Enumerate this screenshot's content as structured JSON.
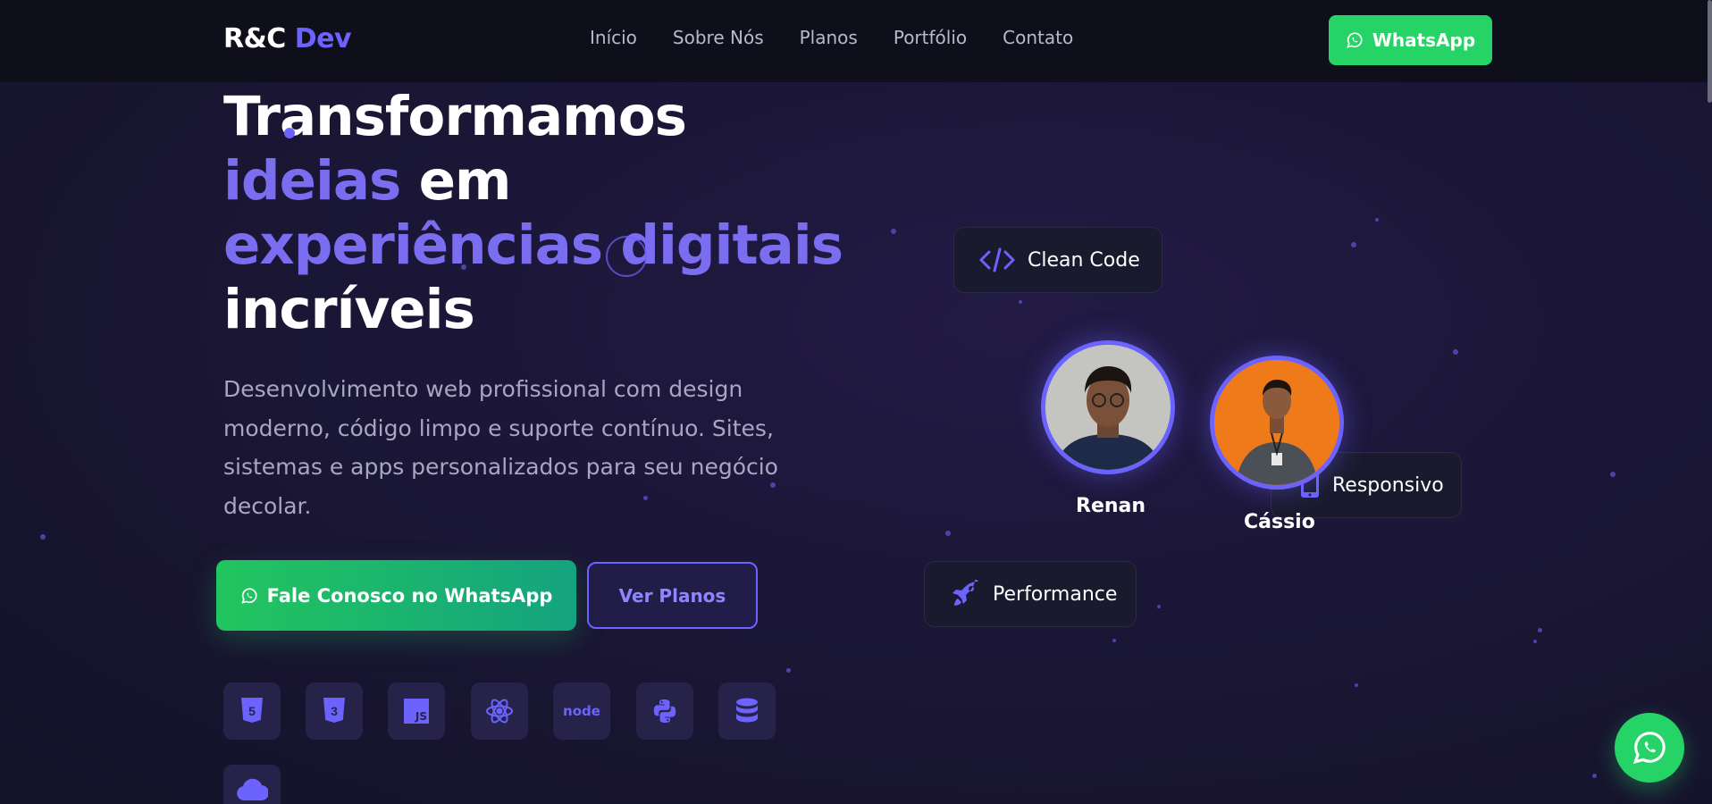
{
  "brand": {
    "name": "R&C",
    "accent": "Dev"
  },
  "nav": {
    "links": [
      "Início",
      "Sobre Nós",
      "Planos",
      "Portfólio",
      "Contato"
    ],
    "cta_label": "WhatsApp"
  },
  "hero": {
    "title_line1": "Transformamos",
    "title_line2_accent": "ideias",
    "title_line2_rest": " em",
    "title_line3_accent": "experiências digitais",
    "title_line4": "incríveis",
    "subtitle": "Desenvolvimento web profissional com design moderno, código limpo e suporte contínuo. Sites, sistemas e apps personalizados para seu negócio decolar.",
    "primary_cta": "Fale Conosco no WhatsApp",
    "secondary_cta": "Ver Planos"
  },
  "tech_stack": [
    "html5-icon",
    "css3-icon",
    "javascript-icon",
    "react-icon",
    "nodejs-icon",
    "python-icon",
    "database-icon",
    "cloud-icon"
  ],
  "tech_labels": {
    "js": "JS",
    "node": "node"
  },
  "features": {
    "clean_code": "Clean Code",
    "responsive": "Responsivo",
    "performance": "Performance"
  },
  "team": [
    {
      "name": "Renan"
    },
    {
      "name": "Cássio"
    }
  ],
  "colors": {
    "accent": "#6c63ff",
    "whatsapp": "#25d366",
    "nav_bg": "#0f0f1c"
  }
}
